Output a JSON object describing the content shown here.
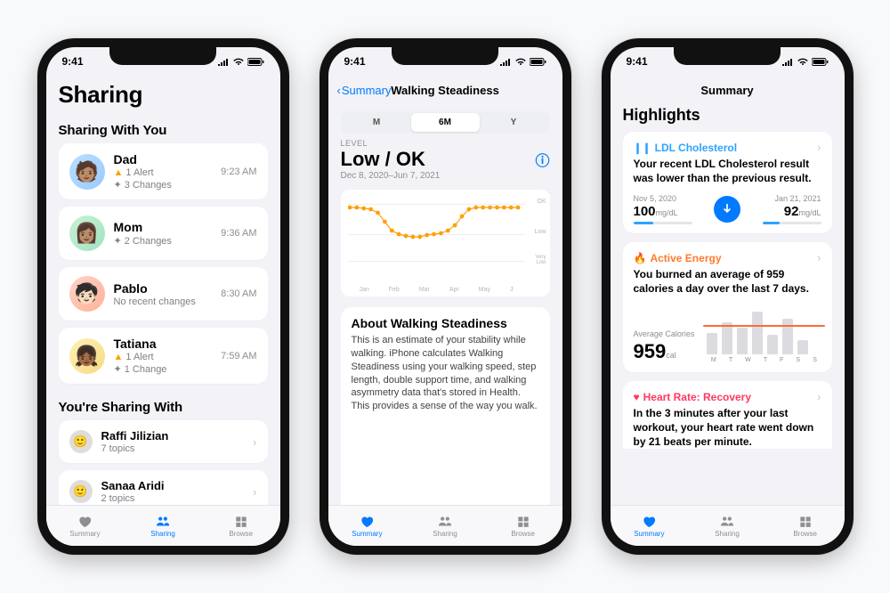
{
  "status_time": "9:41",
  "tabs": {
    "summary": "Summary",
    "sharing": "Sharing",
    "browse": "Browse"
  },
  "sharing": {
    "title": "Sharing",
    "section_in": "Sharing With You",
    "section_out": "You're Sharing With",
    "contacts": [
      {
        "name": "Dad",
        "time": "9:23 AM",
        "alert": "1 Alert",
        "changes": "3 Changes"
      },
      {
        "name": "Mom",
        "time": "9:36 AM",
        "changes": "2 Changes"
      },
      {
        "name": "Pablo",
        "time": "8:30 AM",
        "changes": "No recent changes"
      },
      {
        "name": "Tatiana",
        "time": "7:59 AM",
        "alert": "1 Alert",
        "changes": "1 Change"
      }
    ],
    "outgoing": [
      {
        "name": "Raffi Jilizian",
        "sub": "7 topics"
      },
      {
        "name": "Sanaa Aridi",
        "sub": "2 topics"
      }
    ]
  },
  "steadiness": {
    "nav_back": "Summary",
    "title": "Walking Steadiness",
    "segs": [
      "M",
      "6M",
      "Y"
    ],
    "lvl_label": "LEVEL",
    "level": "Low / OK",
    "range": "Dec 8, 2020–Jun 7, 2021",
    "yaxis": [
      "OK",
      "Low",
      "Very Low"
    ],
    "xlabels": [
      "Jan",
      "Feb",
      "Mar",
      "Apr",
      "May",
      "J"
    ],
    "about_title": "About Walking Steadiness",
    "about_body": "This is an estimate of your stability while walking. iPhone calculates Walking Steadiness using your walking speed, step length, double support time, and walking asymmetry data that's stored in Health. This provides a sense of the way you walk."
  },
  "highlights": {
    "nav": "Summary",
    "title": "Highlights",
    "ldl": {
      "label": "LDL Cholesterol",
      "body": "Your recent LDL Cholesterol result was lower than the previous result.",
      "left_date": "Nov 5, 2020",
      "left_val": "100",
      "left_unit": "mg/dL",
      "right_date": "Jan 21, 2021",
      "right_val": "92",
      "right_unit": "mg/dL"
    },
    "energy": {
      "label": "Active Energy",
      "body": "You burned an average of 959 calories a day over the last 7 days.",
      "avg_label": "Average Calories",
      "avg_val": "959",
      "avg_unit": "cal",
      "days": [
        "M",
        "T",
        "W",
        "T",
        "F",
        "S",
        "S"
      ]
    },
    "hr": {
      "label": "Heart Rate: Recovery",
      "body": "In the 3 minutes after your last workout, your heart rate went down by 21 beats per minute."
    }
  },
  "chart_data": {
    "type": "line",
    "title": "Walking Steadiness",
    "ylabel": "Level",
    "yticks": [
      "OK",
      "Low",
      "Very Low"
    ],
    "x": [
      "Dec",
      "Jan",
      "Feb",
      "Mar",
      "Apr",
      "May",
      "Jun"
    ],
    "y_category": [
      "OK",
      "OK",
      "OK",
      "OK",
      "Low",
      "Low",
      "Low",
      "Low",
      "Low",
      "Low",
      "Low",
      "Low",
      "Low",
      "Low",
      "Low",
      "OK",
      "OK",
      "OK",
      "OK",
      "OK",
      "OK",
      "OK",
      "OK",
      "OK",
      "OK",
      "OK"
    ],
    "note": "weekly points Dec 2020 – Jun 2021, values dip from OK to Low mid-period then return to OK"
  }
}
